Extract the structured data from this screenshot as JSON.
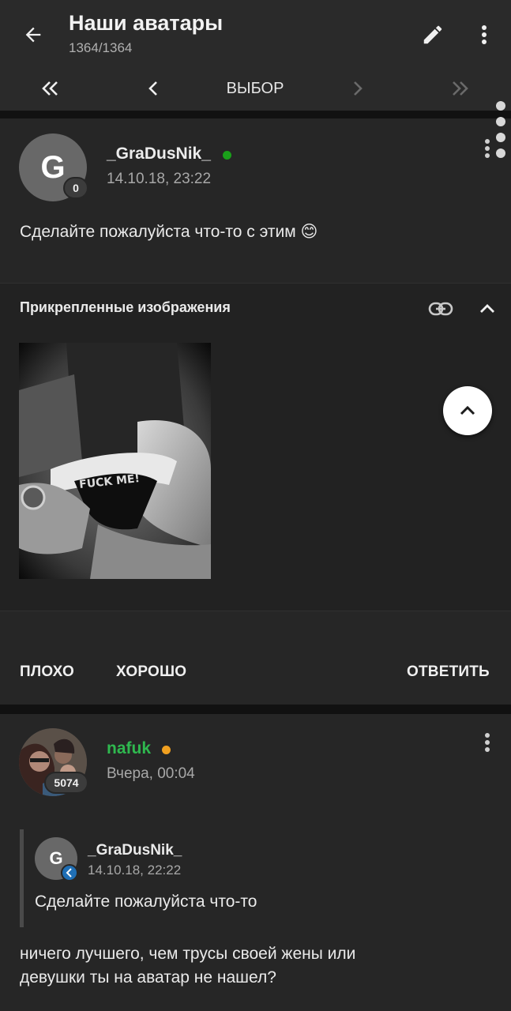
{
  "header": {
    "title": "Наши аватары",
    "subtitle": "1364/1364",
    "back_icon": "arrow-left-icon",
    "edit_icon": "pencil-icon",
    "menu_icon": "vertical-dots-icon"
  },
  "pager": {
    "first_icon": "double-chevron-left-icon",
    "prev_icon": "chevron-left-icon",
    "label": "ВЫБОР",
    "next_icon": "chevron-right-icon",
    "last_icon": "double-chevron-right-icon"
  },
  "post1": {
    "avatar_letter": "G",
    "badge": "0",
    "username": "_GraDusNik_",
    "date": "14.10.18, 23:22",
    "text": "Сделайте пожалуйста что-то с этим 😊",
    "online_color": "#1aa01a",
    "attachments": {
      "title": "Прикрепленные изображения",
      "link_icon": "link-icon",
      "collapse_icon": "chevron-up-icon",
      "image_caption": "FUCK ME!"
    }
  },
  "actions": {
    "bad": "ПЛОХО",
    "good": "ХОРОШО",
    "reply": "ОТВЕТИТЬ"
  },
  "post2": {
    "badge": "5074",
    "username": "nafuk",
    "username_color": "#2fb84f",
    "online_color": "#f0a020",
    "date": "Вчера, 00:04",
    "quote": {
      "avatar_letter": "G",
      "username": "_GraDusNik_",
      "date": "14.10.18, 22:22",
      "text": "Сделайте пожалуйста что-то"
    },
    "text_line1": "ничего лучшего, чем трусы своей жены или",
    "text_line2": "девушки ты на аватар не нашел?"
  },
  "fab_icon": "chevron-up-icon"
}
